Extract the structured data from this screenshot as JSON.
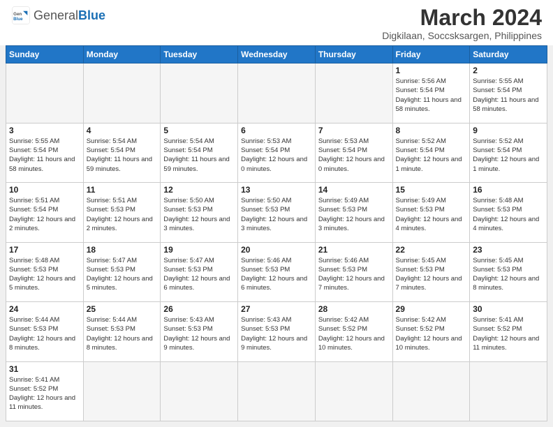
{
  "logo": {
    "text_general": "General",
    "text_blue": "Blue"
  },
  "title": "March 2024",
  "subtitle": "Digkilaan, Soccsksargen, Philippines",
  "days_of_week": [
    "Sunday",
    "Monday",
    "Tuesday",
    "Wednesday",
    "Thursday",
    "Friday",
    "Saturday"
  ],
  "weeks": [
    [
      {
        "day": "",
        "info": ""
      },
      {
        "day": "",
        "info": ""
      },
      {
        "day": "",
        "info": ""
      },
      {
        "day": "",
        "info": ""
      },
      {
        "day": "",
        "info": ""
      },
      {
        "day": "1",
        "info": "Sunrise: 5:56 AM\nSunset: 5:54 PM\nDaylight: 11 hours\nand 58 minutes."
      },
      {
        "day": "2",
        "info": "Sunrise: 5:55 AM\nSunset: 5:54 PM\nDaylight: 11 hours\nand 58 minutes."
      }
    ],
    [
      {
        "day": "3",
        "info": "Sunrise: 5:55 AM\nSunset: 5:54 PM\nDaylight: 11 hours\nand 58 minutes."
      },
      {
        "day": "4",
        "info": "Sunrise: 5:54 AM\nSunset: 5:54 PM\nDaylight: 11 hours\nand 59 minutes."
      },
      {
        "day": "5",
        "info": "Sunrise: 5:54 AM\nSunset: 5:54 PM\nDaylight: 11 hours\nand 59 minutes."
      },
      {
        "day": "6",
        "info": "Sunrise: 5:53 AM\nSunset: 5:54 PM\nDaylight: 12 hours\nand 0 minutes."
      },
      {
        "day": "7",
        "info": "Sunrise: 5:53 AM\nSunset: 5:54 PM\nDaylight: 12 hours\nand 0 minutes."
      },
      {
        "day": "8",
        "info": "Sunrise: 5:52 AM\nSunset: 5:54 PM\nDaylight: 12 hours\nand 1 minute."
      },
      {
        "day": "9",
        "info": "Sunrise: 5:52 AM\nSunset: 5:54 PM\nDaylight: 12 hours\nand 1 minute."
      }
    ],
    [
      {
        "day": "10",
        "info": "Sunrise: 5:51 AM\nSunset: 5:54 PM\nDaylight: 12 hours\nand 2 minutes."
      },
      {
        "day": "11",
        "info": "Sunrise: 5:51 AM\nSunset: 5:53 PM\nDaylight: 12 hours\nand 2 minutes."
      },
      {
        "day": "12",
        "info": "Sunrise: 5:50 AM\nSunset: 5:53 PM\nDaylight: 12 hours\nand 3 minutes."
      },
      {
        "day": "13",
        "info": "Sunrise: 5:50 AM\nSunset: 5:53 PM\nDaylight: 12 hours\nand 3 minutes."
      },
      {
        "day": "14",
        "info": "Sunrise: 5:49 AM\nSunset: 5:53 PM\nDaylight: 12 hours\nand 3 minutes."
      },
      {
        "day": "15",
        "info": "Sunrise: 5:49 AM\nSunset: 5:53 PM\nDaylight: 12 hours\nand 4 minutes."
      },
      {
        "day": "16",
        "info": "Sunrise: 5:48 AM\nSunset: 5:53 PM\nDaylight: 12 hours\nand 4 minutes."
      }
    ],
    [
      {
        "day": "17",
        "info": "Sunrise: 5:48 AM\nSunset: 5:53 PM\nDaylight: 12 hours\nand 5 minutes."
      },
      {
        "day": "18",
        "info": "Sunrise: 5:47 AM\nSunset: 5:53 PM\nDaylight: 12 hours\nand 5 minutes."
      },
      {
        "day": "19",
        "info": "Sunrise: 5:47 AM\nSunset: 5:53 PM\nDaylight: 12 hours\nand 6 minutes."
      },
      {
        "day": "20",
        "info": "Sunrise: 5:46 AM\nSunset: 5:53 PM\nDaylight: 12 hours\nand 6 minutes."
      },
      {
        "day": "21",
        "info": "Sunrise: 5:46 AM\nSunset: 5:53 PM\nDaylight: 12 hours\nand 7 minutes."
      },
      {
        "day": "22",
        "info": "Sunrise: 5:45 AM\nSunset: 5:53 PM\nDaylight: 12 hours\nand 7 minutes."
      },
      {
        "day": "23",
        "info": "Sunrise: 5:45 AM\nSunset: 5:53 PM\nDaylight: 12 hours\nand 8 minutes."
      }
    ],
    [
      {
        "day": "24",
        "info": "Sunrise: 5:44 AM\nSunset: 5:53 PM\nDaylight: 12 hours\nand 8 minutes."
      },
      {
        "day": "25",
        "info": "Sunrise: 5:44 AM\nSunset: 5:53 PM\nDaylight: 12 hours\nand 8 minutes."
      },
      {
        "day": "26",
        "info": "Sunrise: 5:43 AM\nSunset: 5:53 PM\nDaylight: 12 hours\nand 9 minutes."
      },
      {
        "day": "27",
        "info": "Sunrise: 5:43 AM\nSunset: 5:53 PM\nDaylight: 12 hours\nand 9 minutes."
      },
      {
        "day": "28",
        "info": "Sunrise: 5:42 AM\nSunset: 5:52 PM\nDaylight: 12 hours\nand 10 minutes."
      },
      {
        "day": "29",
        "info": "Sunrise: 5:42 AM\nSunset: 5:52 PM\nDaylight: 12 hours\nand 10 minutes."
      },
      {
        "day": "30",
        "info": "Sunrise: 5:41 AM\nSunset: 5:52 PM\nDaylight: 12 hours\nand 11 minutes."
      }
    ],
    [
      {
        "day": "31",
        "info": "Sunrise: 5:41 AM\nSunset: 5:52 PM\nDaylight: 12 hours\nand 11 minutes."
      },
      {
        "day": "",
        "info": ""
      },
      {
        "day": "",
        "info": ""
      },
      {
        "day": "",
        "info": ""
      },
      {
        "day": "",
        "info": ""
      },
      {
        "day": "",
        "info": ""
      },
      {
        "day": "",
        "info": ""
      }
    ]
  ]
}
